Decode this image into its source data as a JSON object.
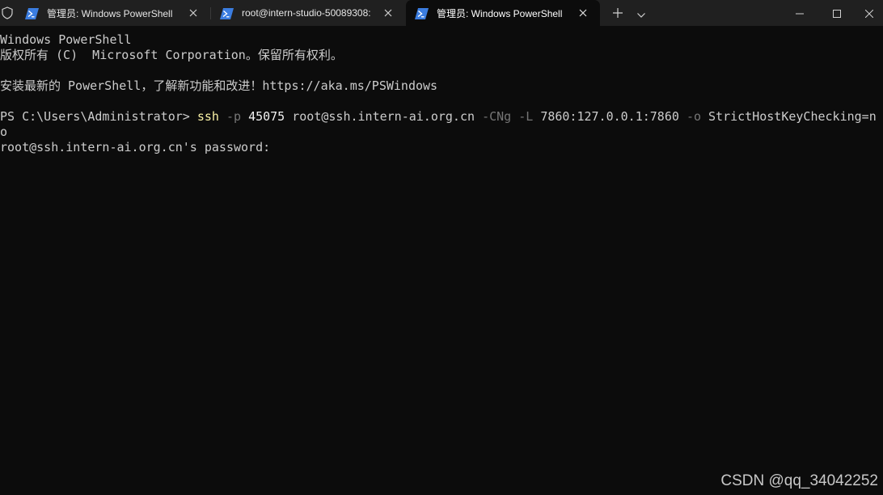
{
  "tabs": [
    {
      "title": "管理员: Windows PowerShell",
      "icon": "powershell-icon"
    },
    {
      "title": "root@intern-studio-50089308:",
      "icon": "powershell-icon"
    },
    {
      "title": "管理员: Windows PowerShell",
      "icon": "powershell-icon"
    }
  ],
  "titlebar_icons": {
    "shield": "shield-icon",
    "new_tab": "plus-icon",
    "dropdown": "chevron-down-icon",
    "minimize": "minimize-icon",
    "maximize": "maximize-icon",
    "close": "close-icon"
  },
  "terminal": {
    "header1": "Windows PowerShell",
    "header2": "版权所有 (C)  Microsoft Corporation。保留所有权利。",
    "install_prefix": "安装最新的 PowerShell，了解新功能和改进！",
    "install_url": "https://aka.ms/PSWindows",
    "prompt": "PS C:\\Users\\Administrator>",
    "cmd": "ssh",
    "opt_p": "-p",
    "port": "45075",
    "host": "root@ssh.intern-ai.org.cn",
    "opt_cng": "-CNg",
    "opt_l": "-L",
    "forward": "7860:127.0.0.1:7860",
    "opt_o": "-o",
    "option_value_1": "StrictHostKeyChecking=n",
    "option_value_2": "o",
    "password_prompt": "root@ssh.intern-ai.org.cn's password:"
  },
  "watermark": "CSDN @qq_34042252",
  "colors": {
    "terminal_bg": "#0c0c0c",
    "titlebar_bg": "#202020",
    "command_yellow": "#f9f1a5",
    "option_gray": "#767676",
    "text": "#cccccc"
  }
}
